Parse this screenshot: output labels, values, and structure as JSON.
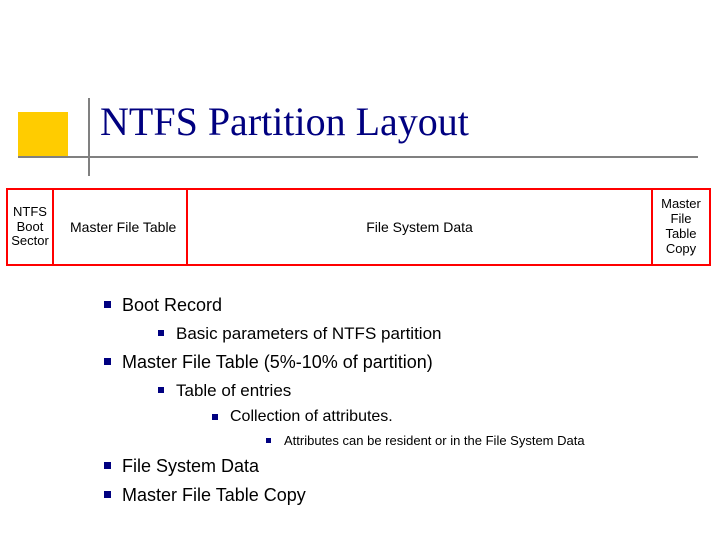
{
  "title": "NTFS Partition Layout",
  "diagram": {
    "cells": [
      "NTFS Boot Sector",
      "Master File Table",
      "File System Data",
      "Master File Table Copy"
    ]
  },
  "bullets": {
    "b1": "Boot Record",
    "b1_1": "Basic parameters of NTFS partition",
    "b2": "Master File Table (5%-10% of partition)",
    "b2_1": "Table of entries",
    "b2_1_1": "Collection of attributes.",
    "b2_1_1_1": "Attributes can be resident or in the File System Data",
    "b3": "File System Data",
    "b4": "Master File Table Copy"
  }
}
